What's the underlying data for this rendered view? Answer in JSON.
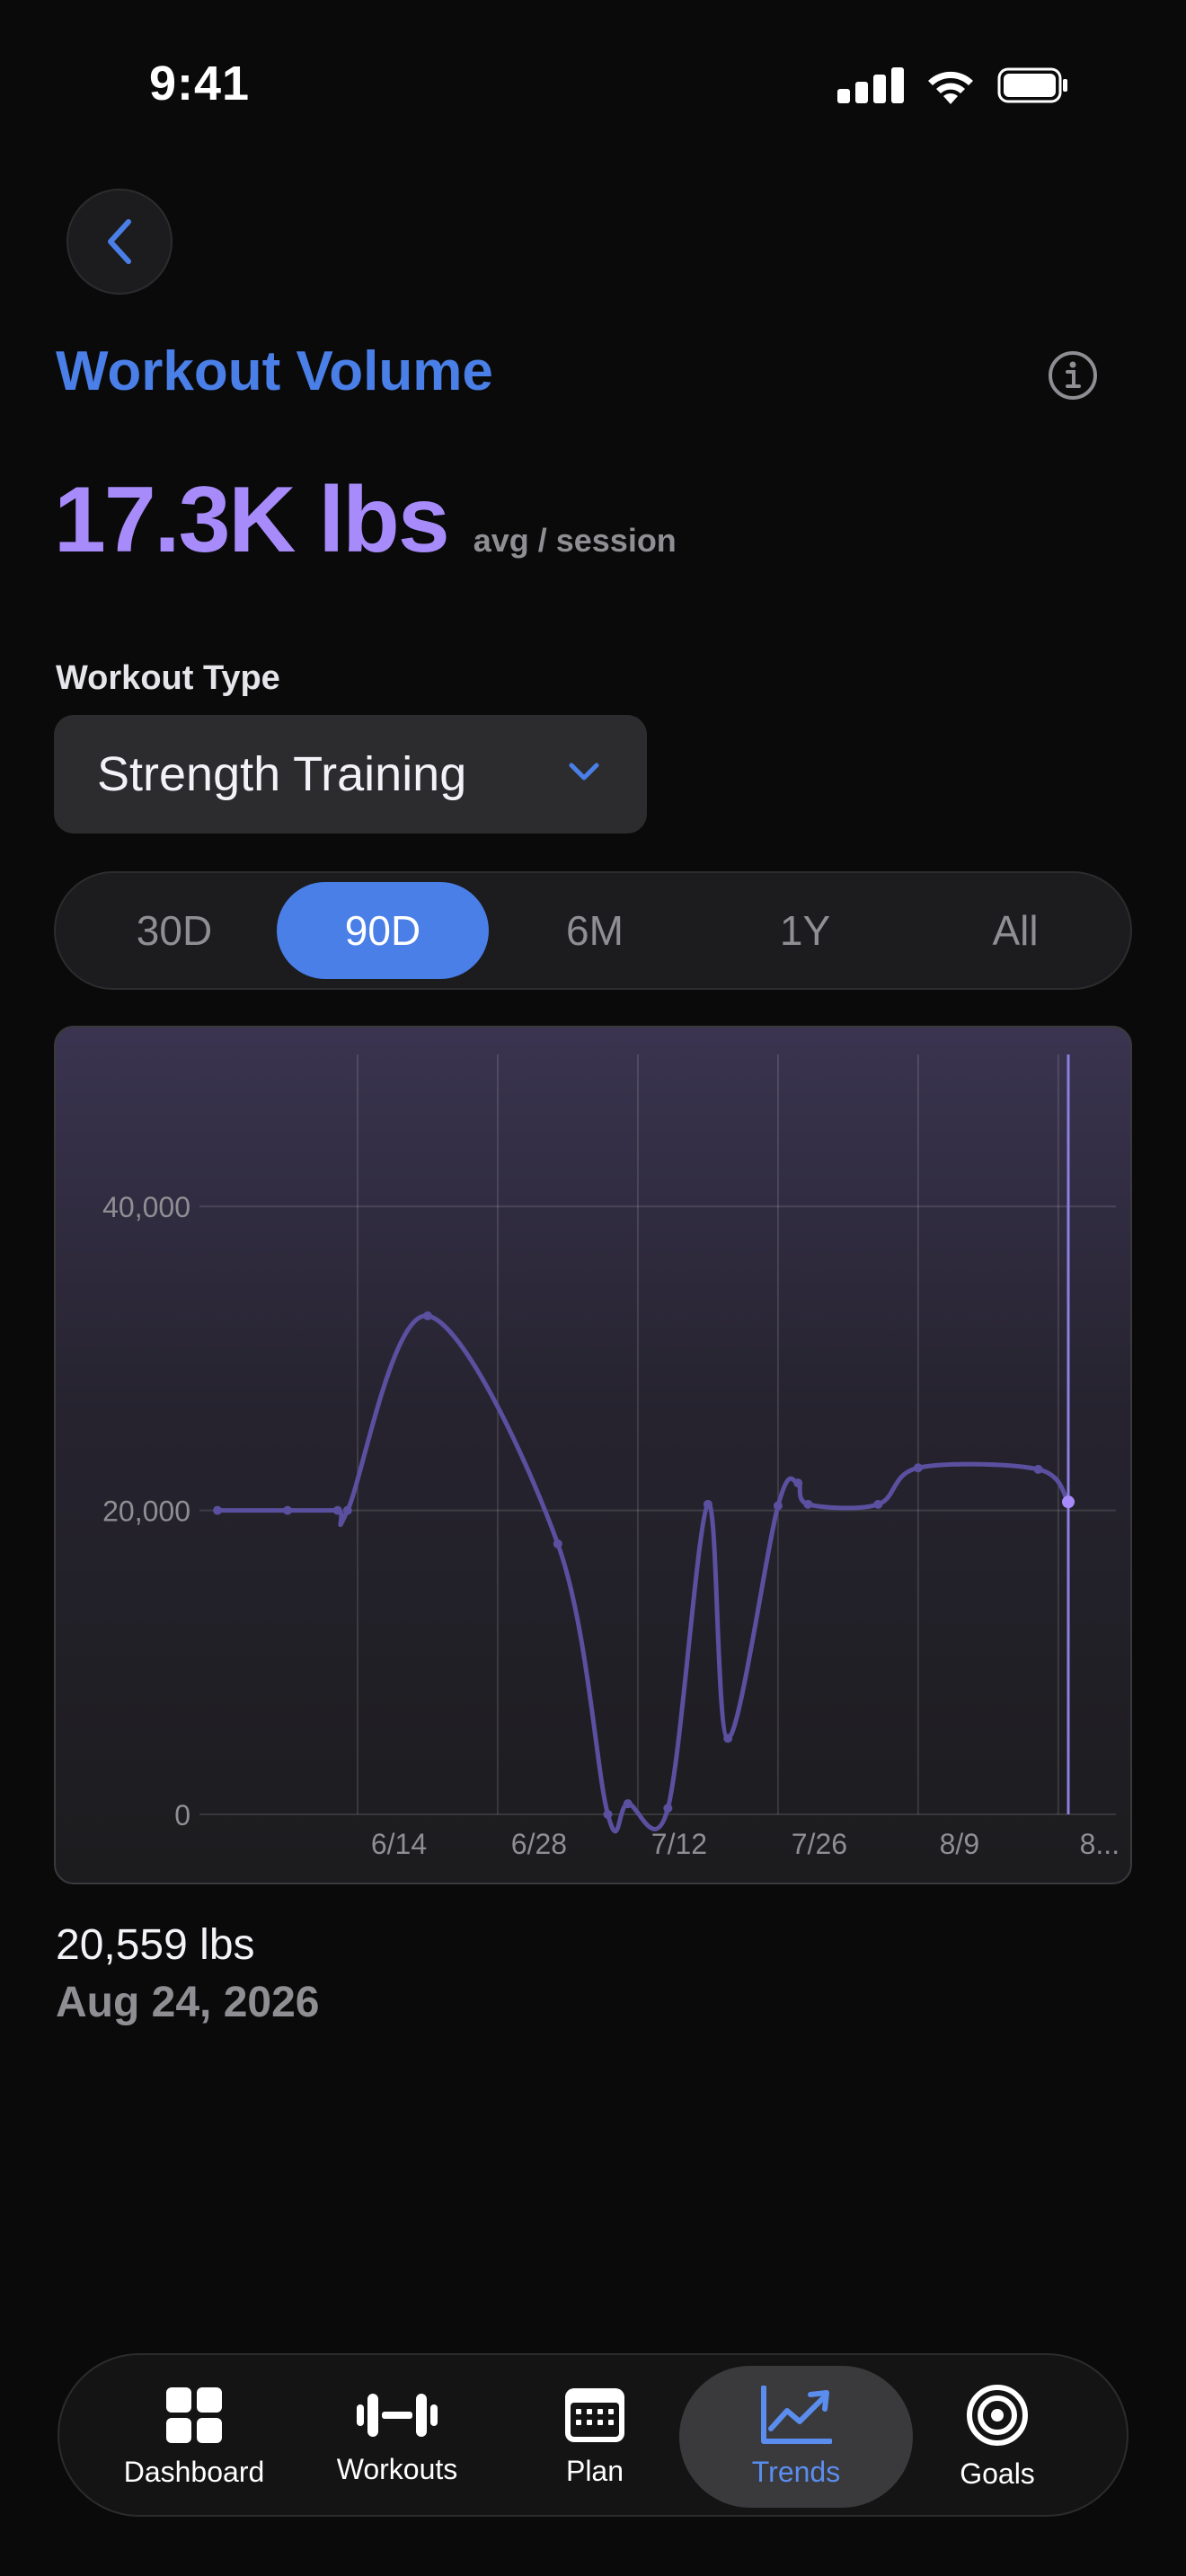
{
  "status": {
    "time": "9:41"
  },
  "header": {
    "title": "Workout Volume"
  },
  "metric": {
    "value": "17.3K lbs",
    "unit": "avg / session"
  },
  "workout_type": {
    "label": "Workout Type",
    "selected": "Strength Training"
  },
  "ranges": [
    {
      "label": "30D",
      "active": false
    },
    {
      "label": "90D",
      "active": true
    },
    {
      "label": "6M",
      "active": false
    },
    {
      "label": "1Y",
      "active": false
    },
    {
      "label": "All",
      "active": false
    }
  ],
  "chart_data": {
    "type": "line",
    "x": [
      "2026-05-31",
      "2026-06-07",
      "2026-06-12",
      "2026-06-13",
      "2026-06-21",
      "2026-07-04",
      "2026-07-09",
      "2026-07-11",
      "2026-07-15",
      "2026-07-19",
      "2026-07-21",
      "2026-07-26",
      "2026-07-28",
      "2026-07-29",
      "2026-08-05",
      "2026-08-09",
      "2026-08-21",
      "2026-08-24"
    ],
    "y": [
      20000,
      20000,
      20000,
      20000,
      32800,
      17800,
      0,
      700,
      400,
      20400,
      5000,
      20300,
      21800,
      20400,
      20400,
      22800,
      22700,
      20559
    ],
    "x_tick_labels": [
      "6/14",
      "6/28",
      "7/12",
      "7/26",
      "8/9",
      "8..."
    ],
    "y_tick_labels": [
      "0",
      "20,000",
      "40,000"
    ],
    "ylim": [
      0,
      50000
    ],
    "grid": true,
    "line_color": "#5b50a0",
    "selected_index": 17
  },
  "readout": {
    "value": "20,559 lbs",
    "date": "Aug 24, 2026"
  },
  "tabs": [
    {
      "label": "Dashboard",
      "icon": "grid-icon",
      "active": false
    },
    {
      "label": "Workouts",
      "icon": "dumbbell-icon",
      "active": false
    },
    {
      "label": "Plan",
      "icon": "calendar-icon",
      "active": false
    },
    {
      "label": "Trends",
      "icon": "trend-chart-icon",
      "active": true
    },
    {
      "label": "Goals",
      "icon": "target-icon",
      "active": false
    }
  ],
  "colors": {
    "accent": "#4a7fe8",
    "metric": "#a78bfa",
    "background": "#0a0a0a"
  }
}
